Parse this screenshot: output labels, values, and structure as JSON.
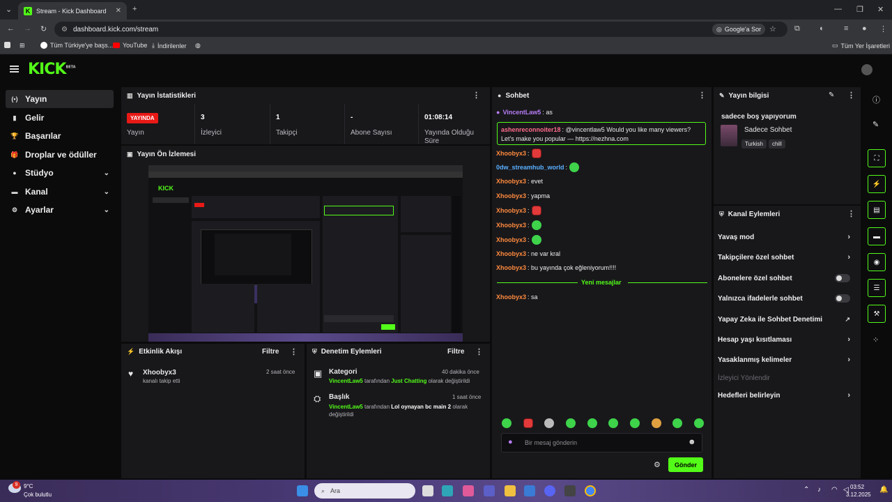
{
  "browser": {
    "tab_title": "Stream - Kick Dashboard",
    "tab_close": "✕",
    "new_tab": "+",
    "url": "dashboard.kick.com/stream",
    "google_button": "Google'a Sor",
    "bookmarks": [
      "Tüm Türkiye'ye başs...",
      "YouTube",
      "İndirilenler"
    ],
    "all_bookmarks": "Tüm Yer İşaretleri",
    "window_controls": [
      "—",
      "❐",
      "✕"
    ]
  },
  "kick": {
    "logo": "KICK",
    "logo_beta": "BETA"
  },
  "sidebar": {
    "items": [
      {
        "label": "Yayın",
        "icon": "(•)",
        "active": true
      },
      {
        "label": "Gelir",
        "icon": "▮"
      },
      {
        "label": "Başarılar",
        "icon": "🏆"
      },
      {
        "label": "Droplar ve ödüller",
        "icon": "🎁"
      },
      {
        "label": "Stüdyo",
        "icon": "●",
        "chevron": "⌄"
      },
      {
        "label": "Kanal",
        "icon": "▬",
        "chevron": "⌄"
      },
      {
        "label": "Ayarlar",
        "icon": "⚙",
        "chevron": "⌄"
      }
    ]
  },
  "stats": {
    "title": "Yayın İstatistikleri",
    "live": "YAYINDA",
    "live_label": "Yayın",
    "items": [
      {
        "value": "3",
        "label": "İzleyici"
      },
      {
        "value": "1",
        "label": "Takipçi"
      },
      {
        "value": "-",
        "label": "Abone Sayısı"
      },
      {
        "value": "01:08:14",
        "label": "Yayında Olduğu Süre"
      }
    ]
  },
  "preview": {
    "title": "Yayın Ön İzlemesi"
  },
  "activity": {
    "title": "Etkinlik Akışı",
    "filter": "Filtre",
    "events": [
      {
        "user": "Xhoobyx3",
        "desc": "kanalı takip etti",
        "time": "2 saat önce"
      }
    ]
  },
  "moderation": {
    "title": "Denetim Eylemleri",
    "filter": "Filtre",
    "items": [
      {
        "type": "Kategori",
        "time": "40 dakika önce",
        "user": "VincentLaw5",
        "by": "tarafından",
        "value": "Just Chatting",
        "suffix": "olarak değiştirildi"
      },
      {
        "type": "Başlık",
        "time": "1 saat önce",
        "user": "VincentLaw5",
        "by": "tarafından",
        "value": "Lol oynayan bc main 2",
        "suffix": "olarak değiştirildi"
      }
    ]
  },
  "chat": {
    "title": "Sohbet",
    "messages": [
      {
        "user": "VincentLaw5",
        "text": "as",
        "color": "#b97df7"
      },
      {
        "user": "Xhoobyx3",
        "text": "",
        "color": "#ff8a3d",
        "emote": "red"
      },
      {
        "user": "0dw_streamhub_world",
        "text": "",
        "color": "#5ab0ff",
        "emote": "green"
      },
      {
        "user": "Xhoobyx3",
        "text": "evet",
        "color": "#ff8a3d"
      },
      {
        "user": "Xhoobyx3",
        "text": "yapma",
        "color": "#ff8a3d"
      },
      {
        "user": "Xhoobyx3",
        "text": "",
        "color": "#ff8a3d",
        "emote": "red"
      },
      {
        "user": "Xhoobyx3",
        "text": "",
        "color": "#ff8a3d",
        "emote": "green"
      },
      {
        "user": "Xhoobyx3",
        "text": "",
        "color": "#ff8a3d",
        "emote": "green"
      },
      {
        "user": "Xhoobyx3",
        "text": "ne var kral",
        "color": "#ff8a3d"
      },
      {
        "user": "Xhoobyx3",
        "text": "bu yayında çok eğleniyorum!!!!",
        "color": "#ff8a3d"
      },
      {
        "user": "Xhoobyx3",
        "text": "sa",
        "color": "#ff8a3d"
      }
    ],
    "highlight": {
      "user": "ashenreconnoiter18",
      "text": "@vincentlaw5 Would you like many viewers? Let's make you popular — https://nezhna.com"
    },
    "new_messages": "Yeni mesajlar",
    "input_placeholder": "Bir mesaj gönderin",
    "send": "Gönder"
  },
  "stream_info": {
    "title": "Yayın bilgisi",
    "stream_title": "sadece boş yapıyorum",
    "category": "Sadece Sohbet",
    "tags": [
      "Turkish",
      "chill"
    ]
  },
  "channel_actions": {
    "title": "Kanal Eylemleri",
    "items": [
      {
        "label": "Yavaş mod",
        "kind": "arrow"
      },
      {
        "label": "Takipçilere özel sohbet",
        "kind": "arrow"
      },
      {
        "label": "Abonelere özel sohbet",
        "kind": "toggle"
      },
      {
        "label": "Yalnızca ifadelerle sohbet",
        "kind": "toggle"
      },
      {
        "label": "Yapay Zeka ile Sohbet Denetimi",
        "kind": "external"
      },
      {
        "label": "Hesap yaşı kısıtlaması",
        "kind": "arrow"
      },
      {
        "label": "Yasaklanmış kelimeler",
        "kind": "arrow"
      },
      {
        "label": "İzleyici Yönlendir",
        "kind": "disabled"
      },
      {
        "label": "Hedefleri belirleyin",
        "kind": "arrow"
      }
    ]
  },
  "taskbar": {
    "temp": "9°C",
    "weather": "Çok bulutlu",
    "badge": "9",
    "search": "Ara",
    "time": "03:52",
    "date": "3.12.2025"
  },
  "colors": {
    "accent": "#53fc18",
    "live": "#e91916",
    "panel": "#18181b"
  }
}
